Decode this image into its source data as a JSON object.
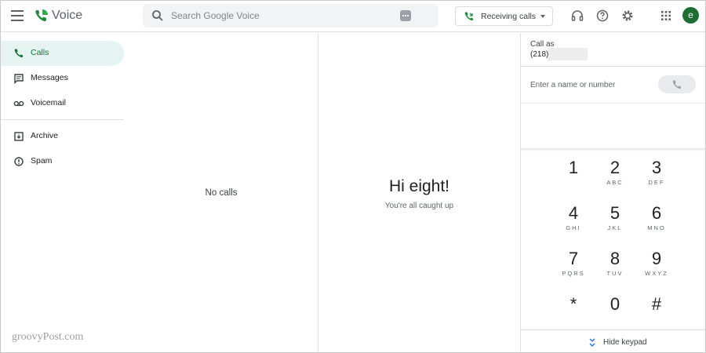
{
  "header": {
    "app_title": "Voice",
    "search_placeholder": "Search Google Voice",
    "receiving_label": "Receiving calls",
    "avatar_letter": "e",
    "brand_color": "#1e8e3e"
  },
  "sidebar": {
    "items": [
      {
        "label": "Calls",
        "icon": "phone-icon",
        "active": true
      },
      {
        "label": "Messages",
        "icon": "message-icon",
        "active": false
      },
      {
        "label": "Voicemail",
        "icon": "voicemail-icon",
        "active": false
      },
      {
        "label": "Archive",
        "icon": "archive-icon",
        "active": false
      },
      {
        "label": "Spam",
        "icon": "spam-icon",
        "active": false
      }
    ]
  },
  "calls_panel": {
    "empty_text": "No calls"
  },
  "center": {
    "greeting": "Hi eight!",
    "subtitle": "You're all caught up"
  },
  "dialer": {
    "call_as_label": "Call as",
    "call_as_number": "(218)",
    "input_placeholder": "Enter a name or number",
    "keys": [
      {
        "digit": "1",
        "letters": ""
      },
      {
        "digit": "2",
        "letters": "ABC"
      },
      {
        "digit": "3",
        "letters": "DEF"
      },
      {
        "digit": "4",
        "letters": "GHI"
      },
      {
        "digit": "5",
        "letters": "JKL"
      },
      {
        "digit": "6",
        "letters": "MNO"
      },
      {
        "digit": "7",
        "letters": "PQRS"
      },
      {
        "digit": "8",
        "letters": "TUV"
      },
      {
        "digit": "9",
        "letters": "WXYZ"
      },
      {
        "digit": "*",
        "letters": ""
      },
      {
        "digit": "0",
        "letters": ""
      },
      {
        "digit": "#",
        "letters": ""
      }
    ],
    "hide_keypad_label": "Hide keypad"
  },
  "watermark": "groovyPost.com"
}
